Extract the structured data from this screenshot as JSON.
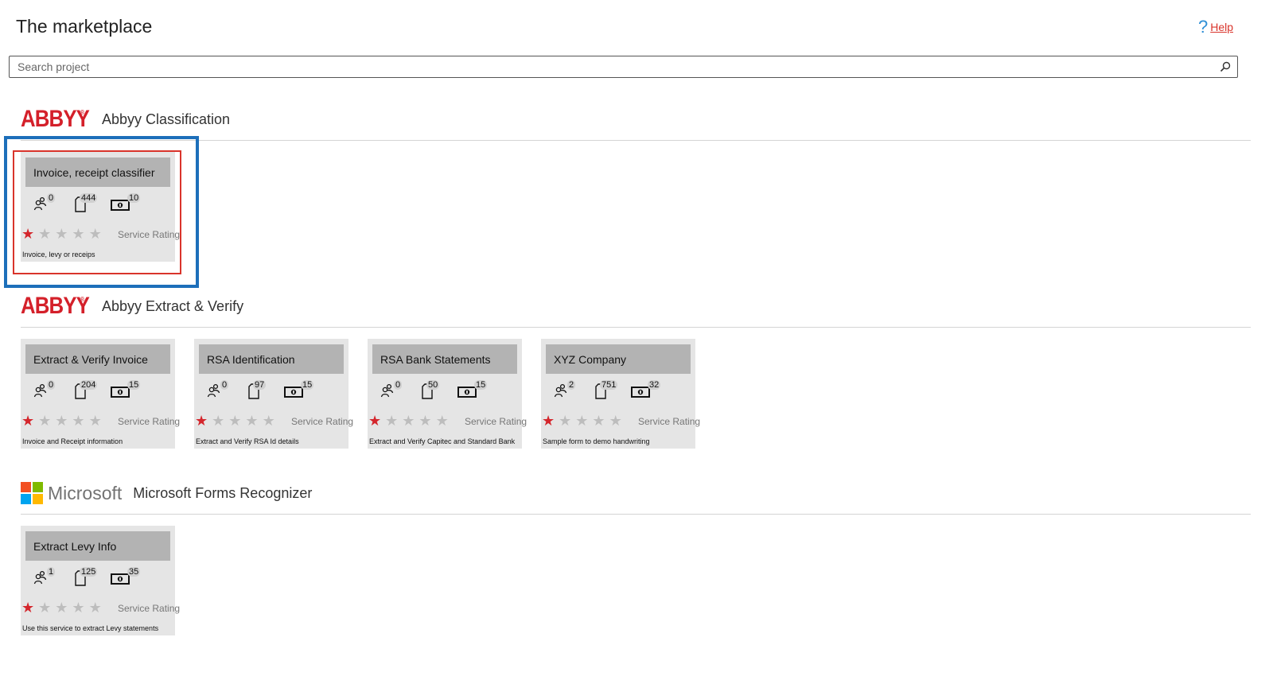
{
  "header": {
    "title": "The marketplace",
    "help_label": "Help"
  },
  "search": {
    "placeholder": "Search project"
  },
  "rating_label": "Service Rating",
  "sections": [
    {
      "brand": "ABBYY",
      "name": "Abbyy Classification",
      "cards": [
        {
          "title": "Invoice, receipt classifier",
          "users": "0",
          "docs": "444",
          "cost": "10",
          "rating": 1,
          "description": "Invoice, levy or receips"
        }
      ]
    },
    {
      "brand": "ABBYY",
      "name": "Abbyy Extract & Verify",
      "cards": [
        {
          "title": "Extract & Verify Invoice",
          "users": "0",
          "docs": "204",
          "cost": "15",
          "rating": 1,
          "description": "Invoice and Receipt information"
        },
        {
          "title": "RSA Identification",
          "users": "0",
          "docs": "97",
          "cost": "15",
          "rating": 1,
          "description": "Extract and Verify RSA Id details"
        },
        {
          "title": "RSA Bank Statements",
          "users": "0",
          "docs": "50",
          "cost": "15",
          "rating": 1,
          "description": "Extract and Verify Capitec and Standard Bank"
        },
        {
          "title": "XYZ Company",
          "users": "2",
          "docs": "751",
          "cost": "32",
          "rating": 1,
          "description": "Sample form to demo handwriting"
        }
      ]
    },
    {
      "brand": "Microsoft",
      "name": "Microsoft Forms Recognizer",
      "cards": [
        {
          "title": "Extract Levy Info",
          "users": "1",
          "docs": "125",
          "cost": "35",
          "rating": 1,
          "description": "Use this service to extract Levy statements"
        }
      ]
    }
  ],
  "colors": {
    "accent_red": "#d4202a",
    "help_blue": "#2e8fd6",
    "highlight_blue": "#1d6fba"
  },
  "microsoft_logo_colors": [
    "#f25022",
    "#7fba00",
    "#00a4ef",
    "#ffb900"
  ]
}
